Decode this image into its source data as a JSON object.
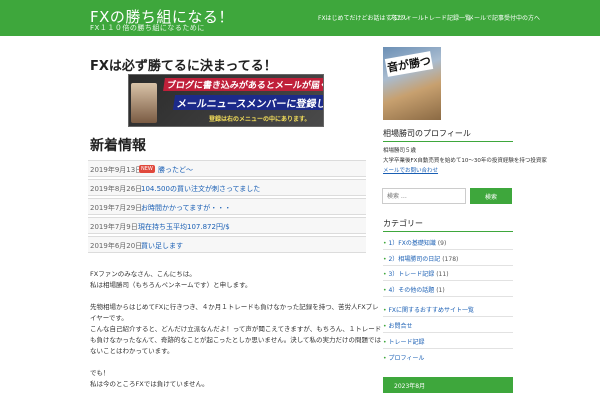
{
  "header": {
    "title": "FXの勝ち組になる！",
    "description": "FX１１０倍の勝ち組になるために",
    "nav": [
      "FXはじめてだけどお話はするかい",
      "プロフィール",
      "トレード記録一覧",
      "メールで記事受付中の方へ"
    ]
  },
  "main": {
    "heading": "FXは必ず勝てるに決まってる！",
    "banner": {
      "line1": "ブログに書き込みがあるとメールが届く!",
      "line2": "メールニュースメンバーに登録しよう。",
      "line3": "登録は右のメニューの中にあります。"
    },
    "news_heading": "新着情報",
    "news": [
      {
        "date": "2019年9月13日",
        "badge": "NEW",
        "text": "勝ったど～"
      },
      {
        "date": "2019年8月26日",
        "badge": "",
        "text": "104.500の買い注文が刺さってました"
      },
      {
        "date": "2019年7月29日",
        "badge": "",
        "text": "お時間かかってますが・・・"
      },
      {
        "date": "2019年7月9日",
        "badge": "",
        "text": "現在持ち玉平均107.872円/$"
      },
      {
        "date": "2019年6月20日",
        "badge": "",
        "text": "買い足します"
      }
    ],
    "body": [
      "FXファンのみなさん、こんにちは。",
      "私は相場勝司（もちろんペンネームです）と申します。",
      "",
      "先物相場からはじめてFXに行きつき、４か月１トレードも負けなかった記録を持つ、苦労人FXプレ",
      "イヤーです。",
      "こんな自己紹介すると、どんだけ立派なんだよ！って声が聞こえてきますが、もちろん、１トレード",
      "も負けなかったなんて、奇跡的なことが起こったとしか思いません。決して私の実力だけの問題では",
      "ないことはわかっています。",
      "",
      "でも！",
      "私は今のところFXでは負けていません。"
    ]
  },
  "sidebar": {
    "image_text": "音が勝つ",
    "profile_heading": "相場勝司のプロフィール",
    "profile_lines": [
      "相場勝司５歳",
      "大学卒業後FX自動売買を始めて10～30年の投資経験を持つ投資家",
      "メールでお問い合わせ"
    ],
    "search_placeholder": "検索 …",
    "search_button": "検索",
    "category_heading": "カテゴリー",
    "categories": [
      {
        "label": "1）FXの基礎知識",
        "count": "(9)"
      },
      {
        "label": "2）相場勝司の日記",
        "count": "(178)"
      },
      {
        "label": "3）トレード記録",
        "count": "(11)"
      },
      {
        "label": "4）その他の話題",
        "count": "(1)"
      }
    ],
    "links": [
      "FXに関するおすすめサイト一覧",
      "お問合せ",
      "トレード記録",
      "プロフィール"
    ],
    "calendar_label": "2023年8月"
  },
  "colors": {
    "brand": "#3ea73c",
    "link": "#1a5fb4",
    "badge": "#e0483c"
  }
}
